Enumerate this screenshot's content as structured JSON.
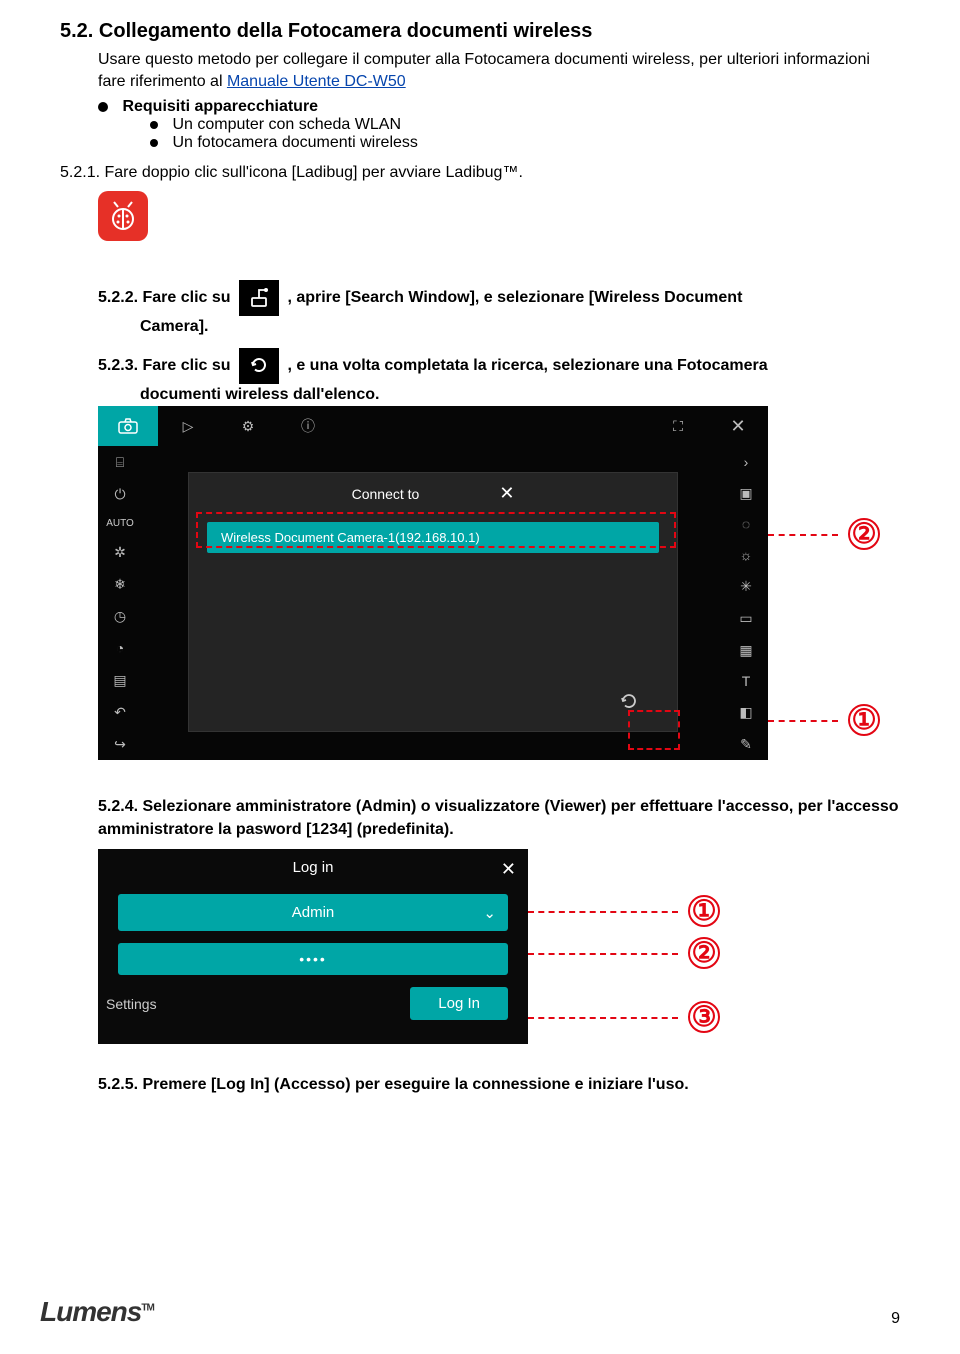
{
  "section": {
    "num": "5.2.",
    "title": "Collegamento della Fotocamera documenti wireless",
    "intro_pre": "Usare questo metodo per collegare il computer alla Fotocamera documenti wireless, per ulteriori informazioni fare riferimento al ",
    "intro_link": "Manuale Utente DC-W50"
  },
  "requirements": {
    "heading": "Requisiti apparecchiature",
    "items": [
      "Un computer con scheda WLAN",
      "Un fotocamera documenti wireless"
    ]
  },
  "steps": {
    "s521": "5.2.1. Fare doppio clic sull'icona [Ladibug] per avviare Ladibug™.",
    "s522_a": "5.2.2. Fare clic su",
    "s522_b": ", aprire [Search Window], e selezionare [Wireless Document Camera].",
    "s522_indent": "Camera].",
    "s523_a": "5.2.3. Fare clic su",
    "s523_b": ", e una volta completata la ricerca, selezionare una Fotocamera documenti wireless dall'elenco.",
    "s524": "5.2.4. Selezionare amministratore (Admin) o visualizzatore (Viewer) per effettuare l'accesso, per l'accesso amministratore la pasword [1234] (predefinita).",
    "s525": "5.2.5. Premere [Log In] (Accesso) per eseguire la connessione e iniziare l'uso."
  },
  "shot1": {
    "connect_to": "Connect to",
    "device": "Wireless Document Camera-1(192.168.10.1)",
    "auto": "AUTO",
    "callout1": "②",
    "callout2": "①"
  },
  "shot2": {
    "login_title": "Log in",
    "admin": "Admin",
    "pwd": "••••",
    "settings": "Settings",
    "login_btn": "Log In",
    "callout1": "①",
    "callout2": "②",
    "callout3": "③"
  },
  "footer": {
    "brand": "Lumens",
    "tm": "TM",
    "page": "9"
  }
}
